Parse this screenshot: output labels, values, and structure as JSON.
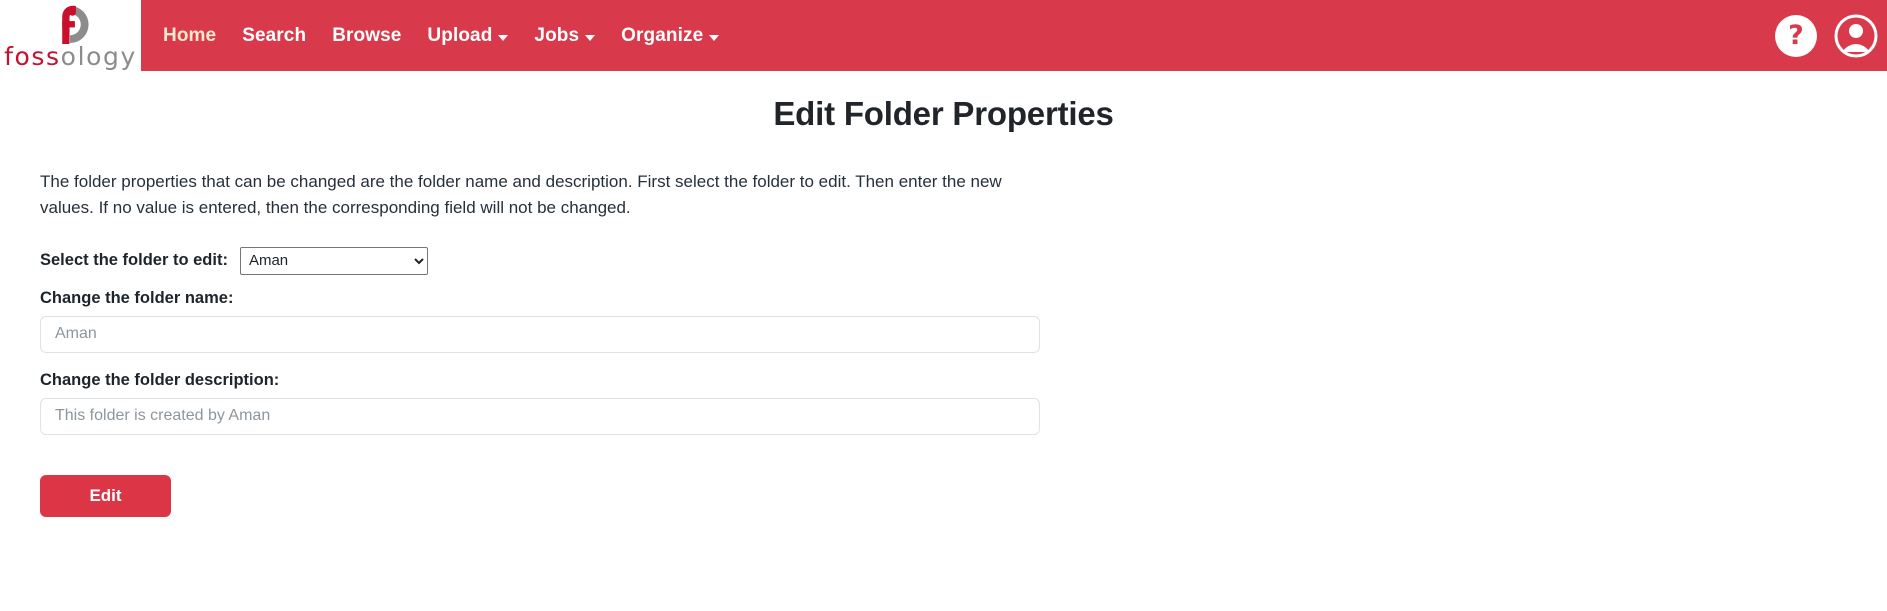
{
  "navbar": {
    "brand": {
      "icon": "fossology-logo-icon",
      "word_red": "foss",
      "word_gray": "ology"
    },
    "links": [
      {
        "label": "Home",
        "has_caret": false,
        "active": true
      },
      {
        "label": "Search",
        "has_caret": false,
        "active": false
      },
      {
        "label": "Browse",
        "has_caret": false,
        "active": false
      },
      {
        "label": "Upload",
        "has_caret": true,
        "active": false
      },
      {
        "label": "Jobs",
        "has_caret": true,
        "active": false
      },
      {
        "label": "Organize",
        "has_caret": true,
        "active": false
      }
    ],
    "help_label": "?",
    "help_icon": "question-mark-icon",
    "user_icon": "user-account-icon",
    "background_color": "#d93a4b",
    "active_link_color": "#ffe9c9"
  },
  "page": {
    "title": "Edit Folder Properties",
    "intro": "The folder properties that can be changed are the folder name and description. First select the folder to edit. Then enter the new values. If no value is entered, then the corresponding field will not be changed."
  },
  "form": {
    "select_label": "Select the folder to edit:",
    "select_value": "Aman",
    "select_options": [
      "Aman"
    ],
    "name_label": "Change the folder name:",
    "name_placeholder": "Aman",
    "name_value": "",
    "description_label": "Change the folder description:",
    "description_placeholder": "This folder is created by Aman",
    "description_value": "",
    "submit_label": "Edit",
    "submit_color": "#dc3545"
  }
}
